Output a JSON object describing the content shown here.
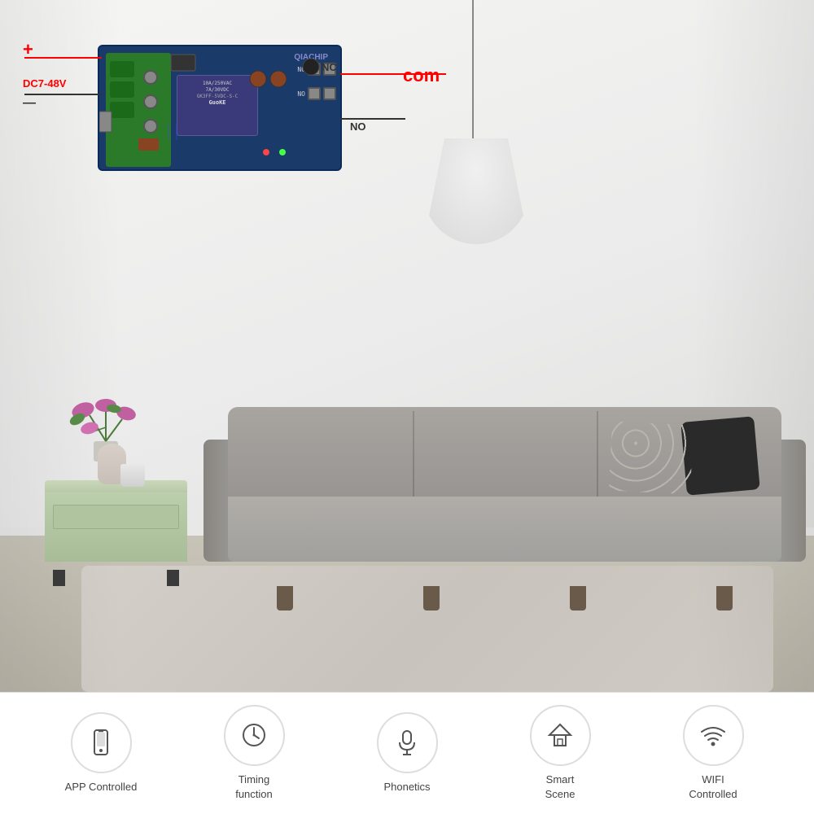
{
  "scene": {
    "wall_color": "#f2f0ee",
    "floor_color": "#c8c4b8"
  },
  "pcb": {
    "brand": "QIACHIP",
    "voltage": "DC7-48V",
    "plus_symbol": "+",
    "minus_symbol": "—",
    "label_com": "com",
    "label_no": "NO",
    "label_nc": "NC",
    "relay_text": "10A/250VAC\n7A/30VDC\nGK3FF-5VDC-S-C\nGuoKE"
  },
  "features": [
    {
      "id": "app-controlled",
      "icon": "smartphone-icon",
      "label": "APP Controlled"
    },
    {
      "id": "timing-function",
      "icon": "clock-icon",
      "label": "Timing\nfunction"
    },
    {
      "id": "phonetics",
      "icon": "microphone-icon",
      "label": "Phonetics"
    },
    {
      "id": "smart-scene",
      "icon": "home-icon",
      "label": "Smart\nScene"
    },
    {
      "id": "wifi-controlled",
      "icon": "wifi-icon",
      "label": "WIFI\nControlled"
    }
  ]
}
